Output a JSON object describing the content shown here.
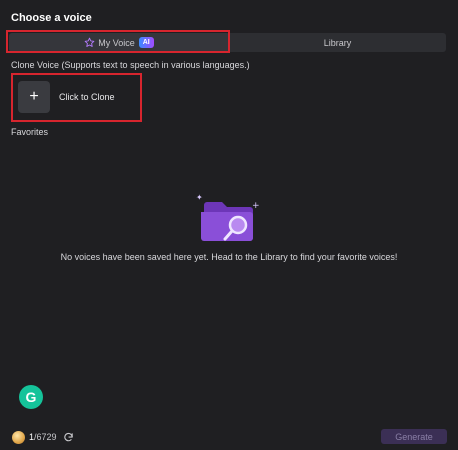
{
  "header": {
    "title": "Choose a voice"
  },
  "tabs": {
    "my_voice": {
      "label": "My Voice",
      "badge": "AI",
      "icon": "star-icon"
    },
    "library": {
      "label": "Library"
    }
  },
  "clone": {
    "section_label": "Clone Voice (Supports text to speech in various languages.)",
    "button_label": "Click to Clone",
    "button_icon": "+"
  },
  "favorites": {
    "section_label": "Favorites",
    "empty_message": "No voices have been saved here yet. Head to the Library to find your favorite voices!"
  },
  "footer": {
    "credits_used": "1",
    "credits_total": "/6729",
    "generate_label": "Generate"
  },
  "colors": {
    "background": "#1f1f22",
    "accent_purple": "#8a4fd8",
    "highlight_red": "#d7252e",
    "generate_bg": "#3b2f55"
  }
}
